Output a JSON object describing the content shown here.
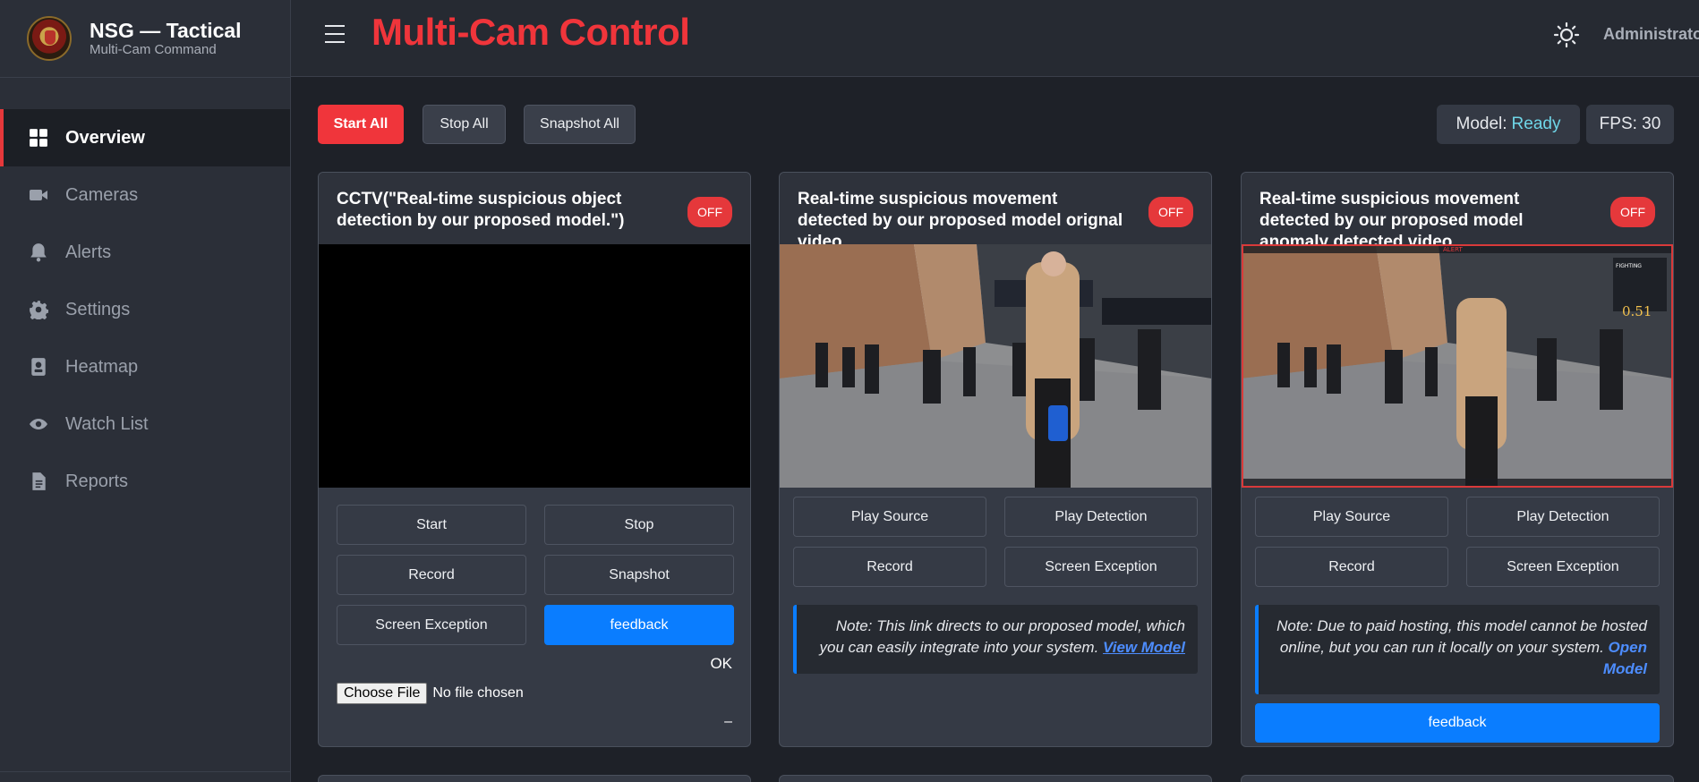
{
  "brand": {
    "title": "NSG — Tactical",
    "subtitle": "Multi-Cam Command"
  },
  "sidebar": {
    "items": [
      {
        "label": "Overview",
        "icon": "grid-icon",
        "active": true
      },
      {
        "label": "Cameras",
        "icon": "video-camera-icon"
      },
      {
        "label": "Alerts",
        "icon": "bell-icon"
      },
      {
        "label": "Settings",
        "icon": "gear-icon"
      },
      {
        "label": "Heatmap",
        "icon": "id-badge-icon"
      },
      {
        "label": "Watch List",
        "icon": "eye-icon"
      },
      {
        "label": "Reports",
        "icon": "document-icon"
      }
    ]
  },
  "header": {
    "title": "Multi-Cam Control",
    "user": "Administrator",
    "theme_icon": "sun-icon"
  },
  "toolbar": {
    "start_all": "Start All",
    "stop_all": "Stop All",
    "snapshot_all": "Snapshot All",
    "model_label": "Model:",
    "model_status": "Ready",
    "fps": "FPS: 30"
  },
  "colors": {
    "accent_red": "#f0353b",
    "accent_blue": "#0a7dff",
    "ready": "#6fd6e8"
  },
  "cards": [
    {
      "title": "CCTV(\"Real-time suspicious object detection by our proposed model.\")",
      "badge": "OFF",
      "buttons": [
        "Start",
        "Stop",
        "Record",
        "Snapshot",
        "Screen Exception",
        "feedback"
      ],
      "status": "OK",
      "file_button": "Choose File",
      "file_status": "No file chosen",
      "footer_mark": "–"
    },
    {
      "title": "Real-time suspicious movement detected by our proposed model orignal video",
      "badge": "OFF",
      "buttons": [
        "Play Source",
        "Play Detection",
        "Record",
        "Screen Exception"
      ],
      "note": "Note: This link directs to our proposed model, which you can easily integrate into your system.",
      "link": "View Model"
    },
    {
      "title": "Real-time suspicious movement detected by our proposed model anomaly detected video",
      "badge": "OFF",
      "buttons": [
        "Play Source",
        "Play Detection",
        "Record",
        "Screen Exception"
      ],
      "note": "Note: Due to paid hosting, this model cannot be hosted online, but you can run it locally on your system.",
      "link": "Open Model",
      "feedback": "feedback",
      "overlay": {
        "alert": "ALERT",
        "class": "FIGHTING",
        "score": "0.51"
      }
    }
  ]
}
